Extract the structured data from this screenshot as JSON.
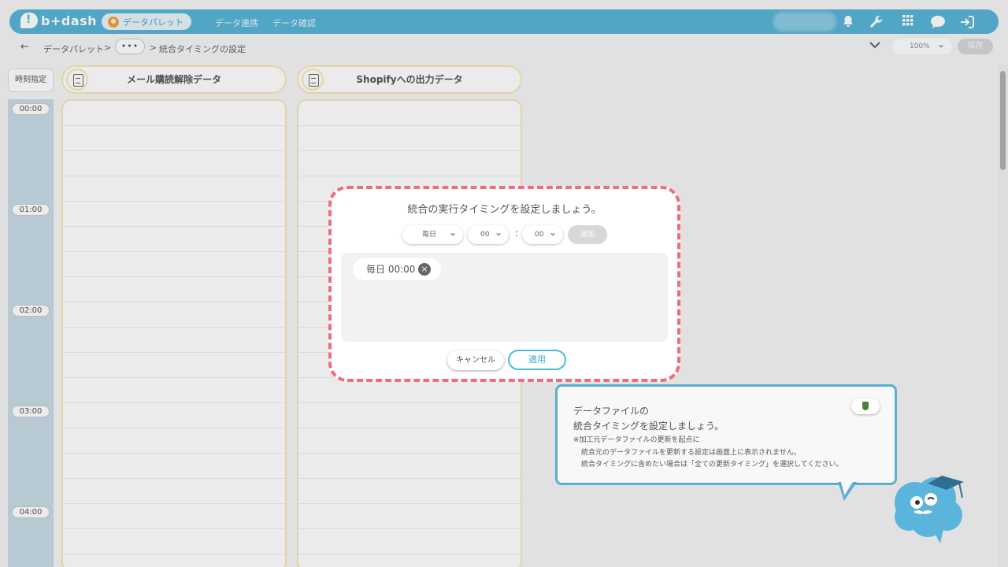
{
  "header": {
    "logo_text": "b+dash",
    "active_nav": "データパレット",
    "nav_links": [
      "データ連携",
      "データ確認"
    ],
    "icons": [
      "bell-icon",
      "wrench-icon",
      "grid-icon",
      "chat-icon",
      "logout-icon"
    ]
  },
  "breadcrumb": {
    "items": [
      "データパレット",
      "統合タイミングの設定"
    ],
    "separator": ">",
    "more": "•••",
    "zoom": "100%",
    "save_label": "保存"
  },
  "schedule": {
    "time_header": "時刻指定",
    "times": [
      "00:00",
      "01:00",
      "02:00",
      "03:00",
      "04:00"
    ],
    "columns": [
      "メール購読解除データ",
      "Shopifyへの出力データ"
    ]
  },
  "modal": {
    "title": "統合の実行タイミングを設定しましょう。",
    "frequency": "毎日",
    "hour": "00",
    "minute": "00",
    "colon": ":",
    "add_label": "追加",
    "chips": [
      "毎日 00:00"
    ],
    "cancel_label": "キャンセル",
    "apply_label": "適用"
  },
  "hint": {
    "title_line1": "データファイルの",
    "title_line2": "統合タイミングを設定しましょう。",
    "note_line1": "※加工元データファイルの更新を起点に",
    "note_line2": "統合元のデータファイルを更新する設定は画面上に表示されません。",
    "note_line3": "統合タイミングに含めたい場合は「全ての更新タイミング」を選択してください。"
  },
  "colors": {
    "header_blue": "#58b3d6",
    "modal_border": "#ee6e80",
    "apply_border": "#4cbbe0",
    "column_border": "#f5e6b4"
  }
}
